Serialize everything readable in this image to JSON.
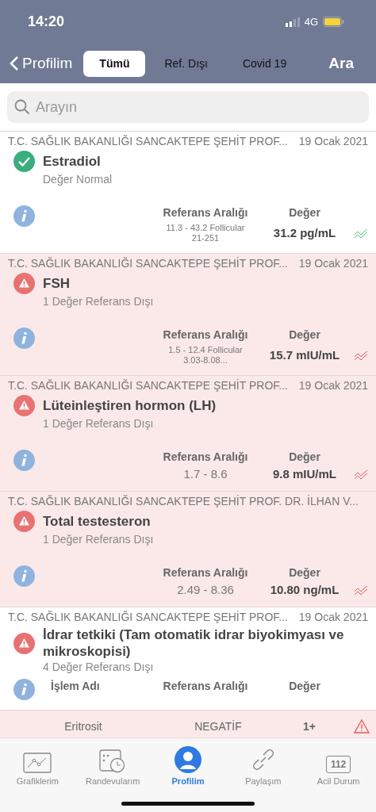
{
  "status_bar": {
    "time": "14:20",
    "network": "4G"
  },
  "nav": {
    "back": "Profilim",
    "tabs": [
      {
        "label": "Tümü",
        "selected": true
      },
      {
        "label": "Ref. Dışı",
        "selected": false
      },
      {
        "label": "Covid 19",
        "selected": false
      }
    ],
    "action": "Ara"
  },
  "search": {
    "placeholder": "Arayın"
  },
  "results": [
    {
      "source": "T.C. SAĞLIK BAKANLIĞI SANCAKTEPE ŞEHİT PROF...",
      "date": "19 Ocak 2021",
      "title": "Estradiol",
      "summary": "Değer Normal",
      "out_of_range": false,
      "highlighted": false,
      "columns": [
        "Referans Aralığı",
        "Değer"
      ],
      "range": [
        "11.3 - 43.2 Follicular",
        "21-251"
      ],
      "value": "31.2 pg/mL"
    },
    {
      "source": "T.C. SAĞLIK BAKANLIĞI SANCAKTEPE ŞEHİT PROF...",
      "date": "19 Ocak 2021",
      "title": "FSH",
      "summary": "1 Değer Referans Dışı",
      "out_of_range": true,
      "highlighted": true,
      "columns": [
        "Referans Aralığı",
        "Değer"
      ],
      "range": [
        "1.5 - 12.4 Follicular",
        "3.03-8.08..."
      ],
      "value": "15.7 mIU/mL"
    },
    {
      "source": "T.C. SAĞLIK BAKANLIĞI SANCAKTEPE ŞEHİT PROF...",
      "date": "19 Ocak 2021",
      "title": "Lüteinleştiren hormon (LH)",
      "summary": "1 Değer Referans Dışı",
      "out_of_range": true,
      "highlighted": true,
      "columns": [
        "Referans Aralığı",
        "Değer"
      ],
      "range": [
        "1.7 - 8.6"
      ],
      "value": "9.8 mIU/mL"
    },
    {
      "source": "T.C. SAĞLIK BAKANLIĞI SANCAKTEPE ŞEHİT PROF. DR. İLHAN V...",
      "title": "Total testesteron",
      "summary": "1 Değer Referans Dışı",
      "out_of_range": true,
      "highlighted": true,
      "columns": [
        "Referans Aralığı",
        "Değer"
      ],
      "range": [
        "2.49 - 8.36"
      ],
      "value": "10.80 ng/mL"
    },
    {
      "source": "T.C. SAĞLIK BAKANLIĞI SANCAKTEPE ŞEHİT PROF...",
      "date": "19 Ocak 2021",
      "title": "İdrar tetkiki (Tam otomatik idrar biyokimyası ve mikroskopisi)",
      "summary": "4 Değer Referans Dışı",
      "out_of_range": true,
      "highlighted": false,
      "columns": [
        "İşlem Adı",
        "Referans Aralığı",
        "Değer"
      ],
      "rows": [
        {
          "name": "Eritrosit",
          "range": "NEGATİF",
          "value": "1+",
          "out_of_range": true
        }
      ]
    }
  ],
  "tab_bar": [
    {
      "label": "Grafiklerim",
      "kind": "chart",
      "selected": false
    },
    {
      "label": "Randevularım",
      "kind": "calendar",
      "selected": false
    },
    {
      "label": "Profilim",
      "kind": "person",
      "selected": true
    },
    {
      "label": "Paylaşım",
      "kind": "link",
      "selected": false
    },
    {
      "label": "Acil Durum",
      "kind": "emergency",
      "icon_text": "112",
      "selected": false
    }
  ]
}
